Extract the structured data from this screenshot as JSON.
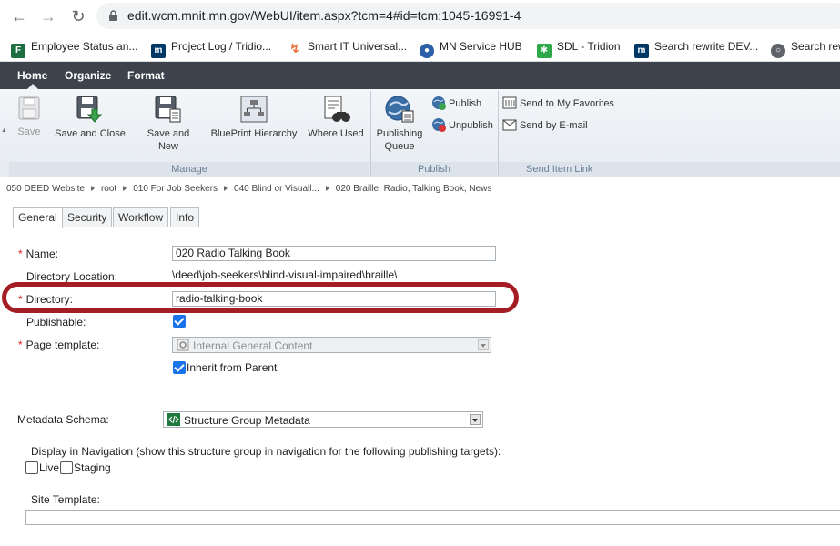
{
  "browser": {
    "url": "edit.wcm.mnit.mn.gov/WebUI/item.aspx?tcm=4#id=tcm:1045-16991-4",
    "bookmarks": [
      {
        "label": "Employee Status an...",
        "icon": "excel-icon",
        "color": "#1d6f42"
      },
      {
        "label": "Project Log / Tridio...",
        "icon": "mn-icon",
        "color": "#003865"
      },
      {
        "label": "Smart IT Universal...",
        "icon": "bolt-icon",
        "color": "#e8703a"
      },
      {
        "label": "MN Service HUB",
        "icon": "hub-icon",
        "color": "#2d5fa8"
      },
      {
        "label": "SDL - Tridion",
        "icon": "sdl-icon",
        "color": "#2ea84a"
      },
      {
        "label": "Search rewrite DEV...",
        "icon": "mn-icon",
        "color": "#003865"
      },
      {
        "label": "Search rew",
        "icon": "globe-icon",
        "color": "#5f6368"
      }
    ]
  },
  "menu": {
    "home": "Home",
    "organize": "Organize",
    "format": "Format"
  },
  "ribbon": {
    "save": "Save",
    "save_close": "Save and Close",
    "save_new_1": "Save and",
    "save_new_2": "New",
    "blueprint": "BluePrint Hierarchy",
    "where_used": "Where Used",
    "publishing_queue_1": "Publishing",
    "publishing_queue_2": "Queue",
    "publish": "Publish",
    "unpublish": "Unpublish",
    "send_favorites": "Send to My Favorites",
    "send_email": "Send by E-mail",
    "group_manage": "Manage",
    "group_publish": "Publish",
    "group_send": "Send Item Link"
  },
  "breadcrumb": [
    "050 DEED Website",
    "root",
    "010 For Job Seekers",
    "040 Blind or Visuall...",
    "020 Braille, Radio, Talking Book, News"
  ],
  "tabs": [
    "General",
    "Security",
    "Workflow",
    "Info"
  ],
  "form": {
    "name_label": "Name:",
    "name_value": "020 Radio Talking Book",
    "dir_location_label": "Directory Location:",
    "dir_location_value": "\\deed\\job-seekers\\blind-visual-impaired\\braille\\",
    "directory_label": "Directory:",
    "directory_value": "radio-talking-book",
    "publishable_label": "Publishable:",
    "page_template_label": "Page template:",
    "page_template_value": "Internal General Content",
    "inherit_label": "Inherit from Parent",
    "metadata_label": "Metadata Schema:",
    "metadata_value": "Structure Group Metadata",
    "display_nav_label": "Display in Navigation (show this structure group in navigation for the following publishing targets):",
    "live_label": "Live",
    "staging_label": "Staging",
    "site_template_label": "Site Template:"
  }
}
